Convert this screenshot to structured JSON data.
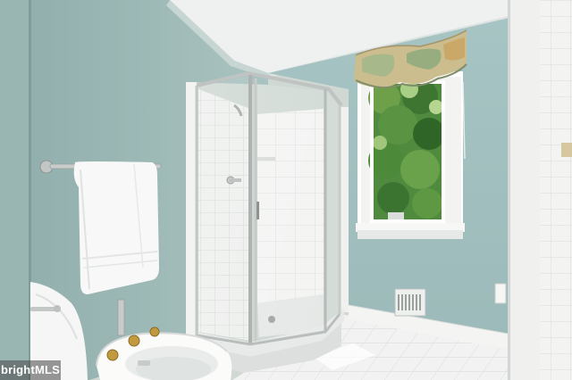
{
  "photo": {
    "subject": "bathroom",
    "watermark": "brightMLS"
  },
  "colors": {
    "wall": "#a9c4c0",
    "wall_shadow": "#8fadab",
    "ceiling": "#eef1f0",
    "tile": "#f2f3f1",
    "trim": "#ffffff",
    "foliage": "#3f7a35",
    "valance_print": "#c9b98a"
  }
}
